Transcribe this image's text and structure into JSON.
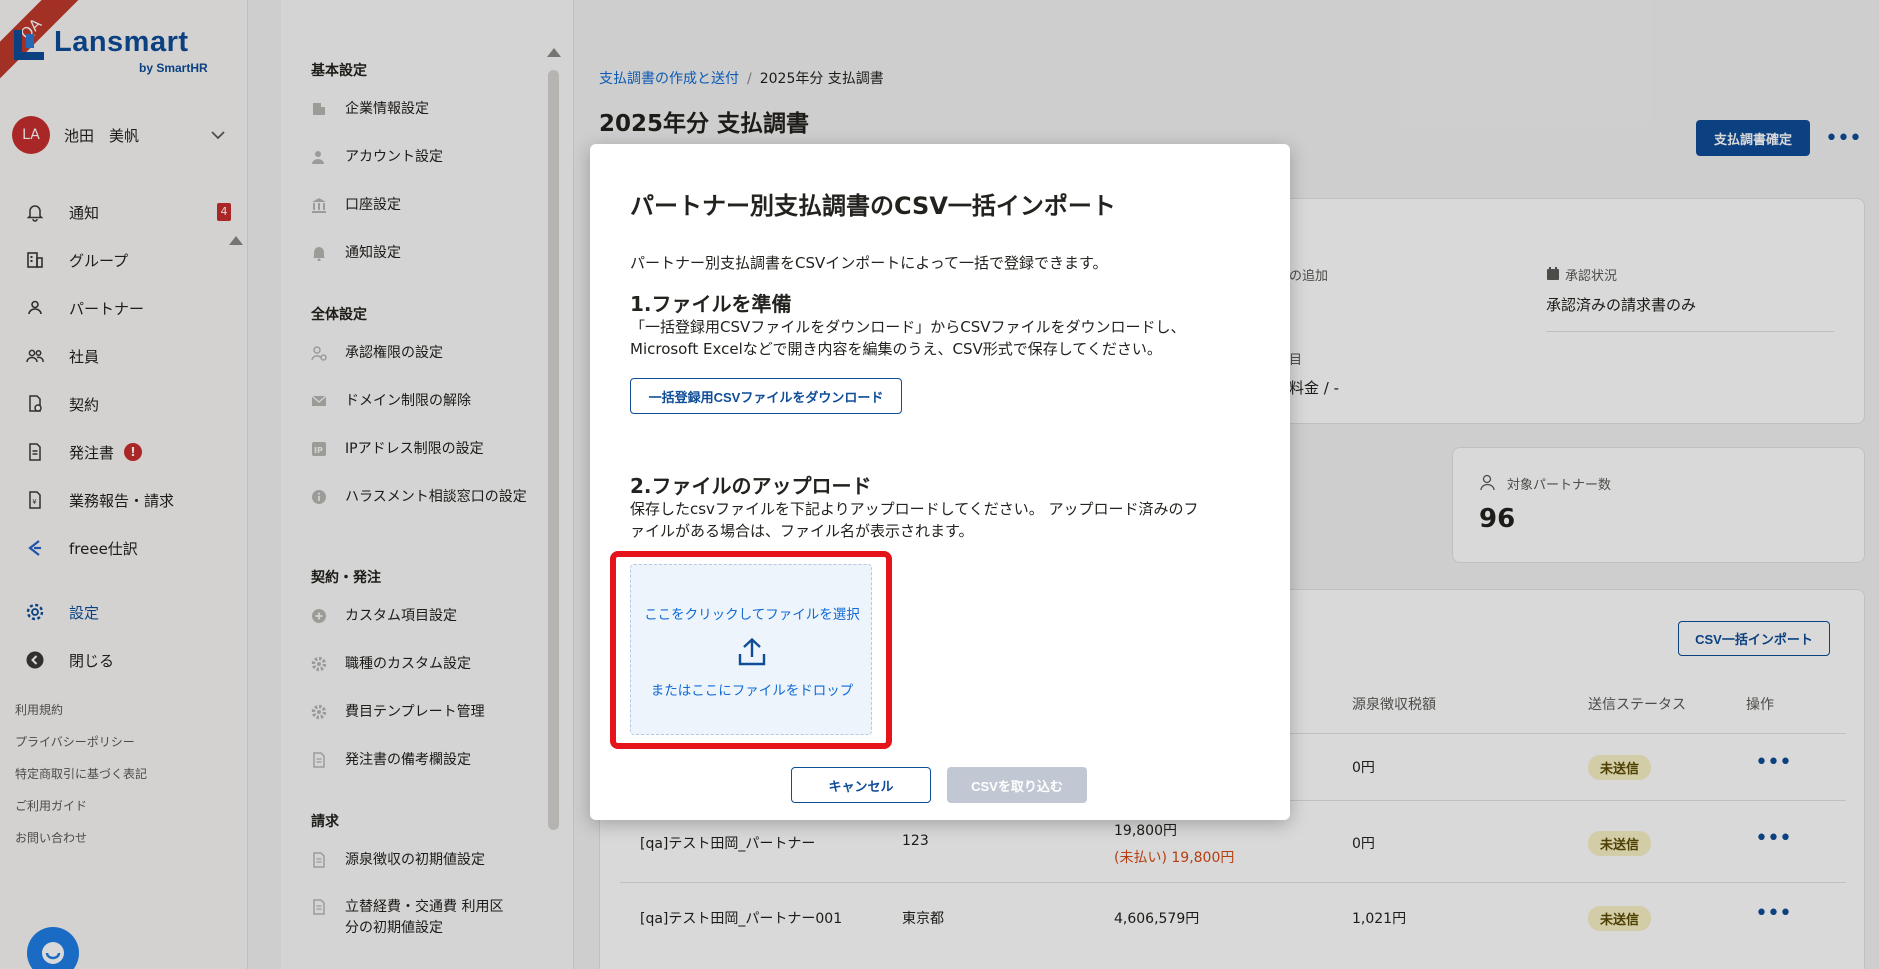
{
  "app": {
    "qa_label": "QA",
    "logo_text": "Lansmart",
    "logo_sub": "by SmartHR"
  },
  "user": {
    "initials": "LA",
    "name": "池田　美帆"
  },
  "nav": {
    "items": [
      {
        "label": "通知",
        "icon": "bell-icon",
        "badge": "4"
      },
      {
        "label": "グループ",
        "icon": "building-icon"
      },
      {
        "label": "パートナー",
        "icon": "person-icon"
      },
      {
        "label": "社員",
        "icon": "people-icon"
      },
      {
        "label": "契約",
        "icon": "contract-icon"
      },
      {
        "label": "発注書",
        "icon": "document-icon",
        "alert": "!"
      },
      {
        "label": "業務報告・請求",
        "icon": "invoice-icon"
      },
      {
        "label": "freee仕訳",
        "icon": "freee-icon"
      }
    ],
    "settings": "設定",
    "close": "閉じる",
    "footer": [
      "利用規約",
      "プライバシーポリシー",
      "特定商取引に基づく表記",
      "ご利用ガイド",
      "お問い合わせ"
    ]
  },
  "submenu": {
    "sections": [
      {
        "title": "基本設定",
        "items": [
          "企業情報設定",
          "アカウント設定",
          "口座設定",
          "通知設定"
        ]
      },
      {
        "title": "全体設定",
        "items": [
          "承認権限の設定",
          "ドメイン制限の解除",
          "IPアドレス制限の設定",
          "ハラスメント相談窓口の設定"
        ]
      },
      {
        "title": "契約・発注",
        "items": [
          "カスタム項目設定",
          "職種のカスタム設定",
          "費目テンプレート管理",
          "発注書の備考欄設定"
        ]
      },
      {
        "title": "請求",
        "items": [
          "源泉徴収の初期値設定",
          "立替経費・交通費 利用区分の初期値設定"
        ]
      }
    ]
  },
  "main": {
    "breadcrumb": {
      "parent": "支払調書の作成と送付",
      "current": "2025年分 支払調書"
    },
    "title": "2025年分 支払調書",
    "confirm_button": "支払調書確定",
    "kebab": "•••",
    "info": {
      "add_label_fragment": "の追加",
      "approval_label": "承認状況",
      "approval_value": "承認済みの請求書のみ",
      "item_label_fragment": "目",
      "item_value_fragment": "料金 / -"
    },
    "partner_count": {
      "label": "対象パートナー数",
      "value": "96"
    },
    "csv_button": "CSV一括インポート",
    "table": {
      "headers": [
        "源泉徴収税額",
        "送信ステータス",
        "操作"
      ],
      "rows": [
        {
          "name": "",
          "address": "",
          "amount": "",
          "unpaid": "",
          "tax": "0円",
          "status": "未送信"
        },
        {
          "name": "[qa]テスト田岡_パートナー",
          "address": "123",
          "amount": "19,800円",
          "unpaid": "(未払い) 19,800円",
          "tax": "0円",
          "status": "未送信"
        },
        {
          "name": "[qa]テスト田岡_パートナー001",
          "address": "東京都",
          "amount": "4,606,579円",
          "unpaid": "",
          "tax": "1,021円",
          "status": "未送信"
        }
      ]
    }
  },
  "modal": {
    "title": "パートナー別支払調書のCSV一括インポート",
    "description": "パートナー別支払調書をCSVインポートによって一括で登録できます。",
    "step1": {
      "title": "1.ファイルを準備",
      "text_line1": "「一括登録用CSVファイルをダウンロード」からCSVファイルをダウンロードし、",
      "text_line2": "Microsoft Excelなどで開き内容を編集のうえ、CSV形式で保存してください。",
      "button": "一括登録用CSVファイルをダウンロード"
    },
    "step2": {
      "title": "2.ファイルのアップロード",
      "text_line1": "保存したcsvファイルを下記よりアップロードしてください。 アップロード済みのフ",
      "text_line2": "ァイルがある場合は、ファイル名が表示されます。",
      "drop_line1": "ここをクリックしてファイルを選択",
      "drop_line2": "またはここにファイルをドロップ"
    },
    "cancel": "キャンセル",
    "import": "CSVを取り込む"
  }
}
